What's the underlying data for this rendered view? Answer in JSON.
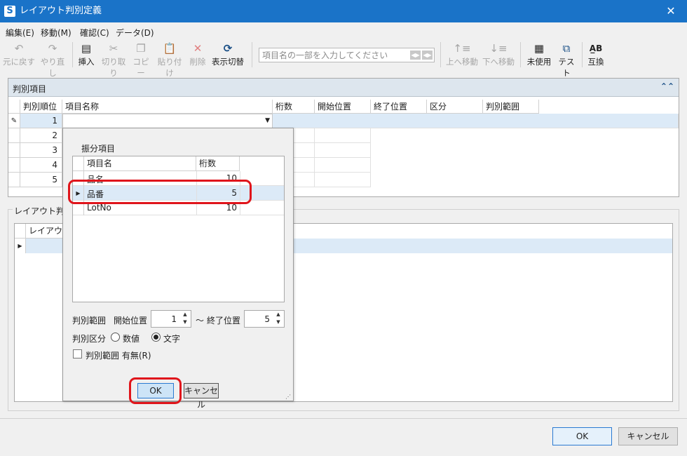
{
  "window": {
    "title": "レイアウト判別定義",
    "logo": "S",
    "close": "✕"
  },
  "menu": [
    "編集(E)",
    "移動(M)",
    "確認(C)",
    "データ(D)"
  ],
  "toolbar": {
    "undo": "元に戻す",
    "redo": "やり直し",
    "insert": "挿入",
    "cut": "切り取り",
    "copy": "コピー",
    "paste": "貼り付け",
    "delete": "削除",
    "toggle_view": "表示切替",
    "move_up": "上へ移動",
    "move_down": "下へ移動",
    "unused": "未使用",
    "test": "テスト",
    "swap": "互換"
  },
  "search": {
    "placeholder": "項目名の一部を入力してください"
  },
  "panel1": {
    "title": "判別項目",
    "columns": [
      "判別順位",
      "項目名称",
      "桁数",
      "開始位置",
      "終了位置",
      "区分",
      "判別範囲"
    ],
    "rows": [
      "1",
      "2",
      "3",
      "4",
      "5"
    ]
  },
  "panel2": {
    "title": "レイアウト判別",
    "columns": [
      "レイアウト"
    ]
  },
  "popup": {
    "title": "振分項目",
    "columns": [
      "項目名",
      "桁数"
    ],
    "rows": [
      {
        "name": "品名",
        "digits": "10"
      },
      {
        "name": "品番",
        "digits": "5"
      },
      {
        "name": "LotNo",
        "digits": "10"
      }
    ],
    "range_label": "判別範囲",
    "start_label": "開始位置",
    "start_value": "1",
    "tilde": "～",
    "end_label": "終了位置",
    "end_value": "5",
    "kind_label": "判別区分",
    "kind_numeric": "数値",
    "kind_text": "文字",
    "range_enabled": "判別範囲 有無(R)",
    "ok": "OK",
    "cancel": "キャンセル"
  },
  "footer": {
    "ok": "OK",
    "cancel": "キャンセル"
  },
  "colors": {
    "titlebar": "#1a73c8",
    "highlight": "#e0151b",
    "selected_row": "#dceaf7"
  }
}
